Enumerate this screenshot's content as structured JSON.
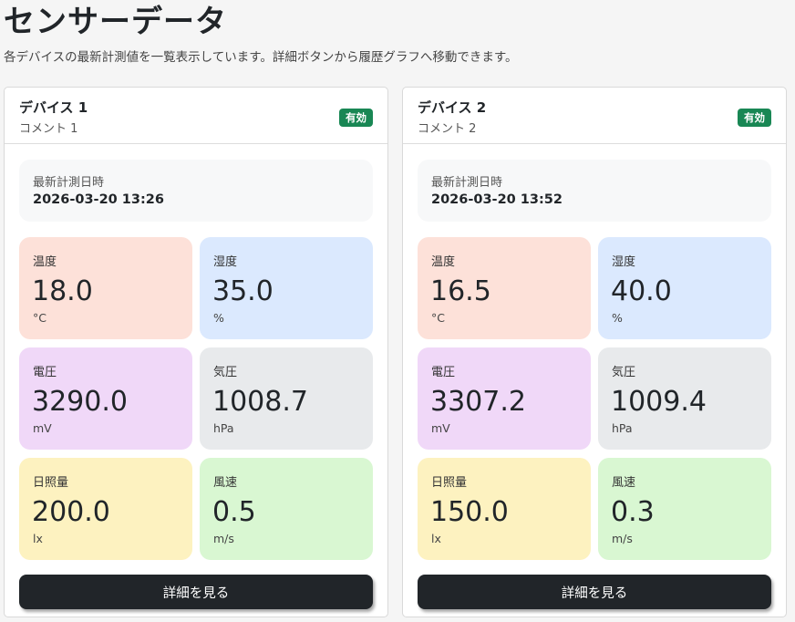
{
  "page": {
    "title": "センサーデータ",
    "description": "各デバイスの最新計測値を一覧表示しています。詳細ボタンから履歴グラフへ移動できます。"
  },
  "devices": [
    {
      "name": "デバイス 1",
      "comment": "コメント 1",
      "status": "有効",
      "latest_label": "最新計測日時",
      "latest_value": "2026-03-20 13:26",
      "metrics": {
        "temperature": {
          "label": "温度",
          "value": "18.0",
          "unit": "°C"
        },
        "humidity": {
          "label": "湿度",
          "value": "35.0",
          "unit": "%"
        },
        "voltage": {
          "label": "電圧",
          "value": "3290.0",
          "unit": "mV"
        },
        "pressure": {
          "label": "気圧",
          "value": "1008.7",
          "unit": "hPa"
        },
        "illuminance": {
          "label": "日照量",
          "value": "200.0",
          "unit": "lx"
        },
        "wind": {
          "label": "風速",
          "value": "0.5",
          "unit": "m/s"
        }
      },
      "detail_label": "詳細を見る"
    },
    {
      "name": "デバイス 2",
      "comment": "コメント 2",
      "status": "有効",
      "latest_label": "最新計測日時",
      "latest_value": "2026-03-20 13:52",
      "metrics": {
        "temperature": {
          "label": "温度",
          "value": "16.5",
          "unit": "°C"
        },
        "humidity": {
          "label": "湿度",
          "value": "40.0",
          "unit": "%"
        },
        "voltage": {
          "label": "電圧",
          "value": "3307.2",
          "unit": "mV"
        },
        "pressure": {
          "label": "気圧",
          "value": "1009.4",
          "unit": "hPa"
        },
        "illuminance": {
          "label": "日照量",
          "value": "150.0",
          "unit": "lx"
        },
        "wind": {
          "label": "風速",
          "value": "0.3",
          "unit": "m/s"
        }
      },
      "detail_label": "詳細を見る"
    }
  ],
  "colors": {
    "status_active": "#198754",
    "temperature_bg": "#fde1d9",
    "humidity_bg": "#dbe9fe",
    "voltage_bg": "#f0d8f8",
    "pressure_bg": "#e8eaec",
    "illuminance_bg": "#fdf2c0",
    "wind_bg": "#d9f7d2",
    "button_bg": "#212529"
  }
}
